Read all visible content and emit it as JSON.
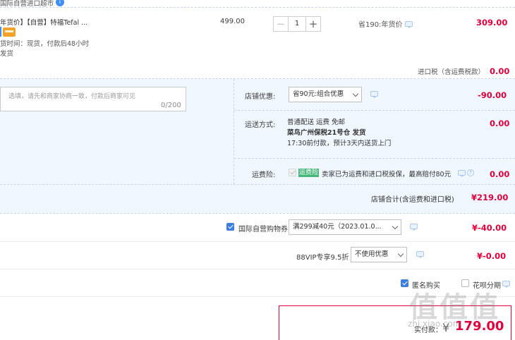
{
  "store": {
    "name": "国际自营进口超市",
    "badge": "i"
  },
  "item": {
    "title": "年货价】【自营】特福Tefal ...",
    "ship_time": "货时间：现货，付款后48小时",
    "ship_word": "发货",
    "unit_price": "499.00",
    "quantity": "1",
    "decrement": "−",
    "increment": "+",
    "savings": "省190:年货价",
    "total": "309.00"
  },
  "tax": {
    "label": "进口税（含运费税款）",
    "value": "0.00"
  },
  "note": {
    "placeholder": "选填，请先和商家协商一致，付款后商家可见",
    "count": "0/200"
  },
  "promo": {
    "label": "店铺优惠:",
    "selected": "省90元:组合优惠",
    "value": "-90.00"
  },
  "shipping": {
    "label": "运送方式:",
    "line1": "普通配送 运费 免邮",
    "line2": "菜鸟广州保税21号仓   发货",
    "line3": "17:30前付款，预计3天内送货上门",
    "value": "0.00"
  },
  "insurance": {
    "label": "运费险:",
    "tag": "运费险",
    "desc": "卖家已为运费和进口税投保，最高赔付80元",
    "help": "?",
    "value": "0.00"
  },
  "store_total": {
    "label": "店铺合计(含运费和进口税)",
    "value": "¥219.00"
  },
  "coupon": {
    "label": "国际自营购物券",
    "selected": "满299减40元（2023.01.0...",
    "value": "¥-40.00"
  },
  "vip": {
    "label": "88VIP专享9.5折",
    "selected": "不使用优惠",
    "value": "¥-0.00"
  },
  "options": {
    "anonymous": "匿名购买",
    "huabei": "花呗分期"
  },
  "payment": {
    "label": "实付款：",
    "yen": "¥",
    "value": "179.00"
  },
  "watermark": {
    "big": "值值值",
    "small": "zhi.xiao.com"
  },
  "colors": {
    "accent": "#e4003a",
    "blue": "#3d7fe0",
    "band": "#f1f7ff"
  }
}
